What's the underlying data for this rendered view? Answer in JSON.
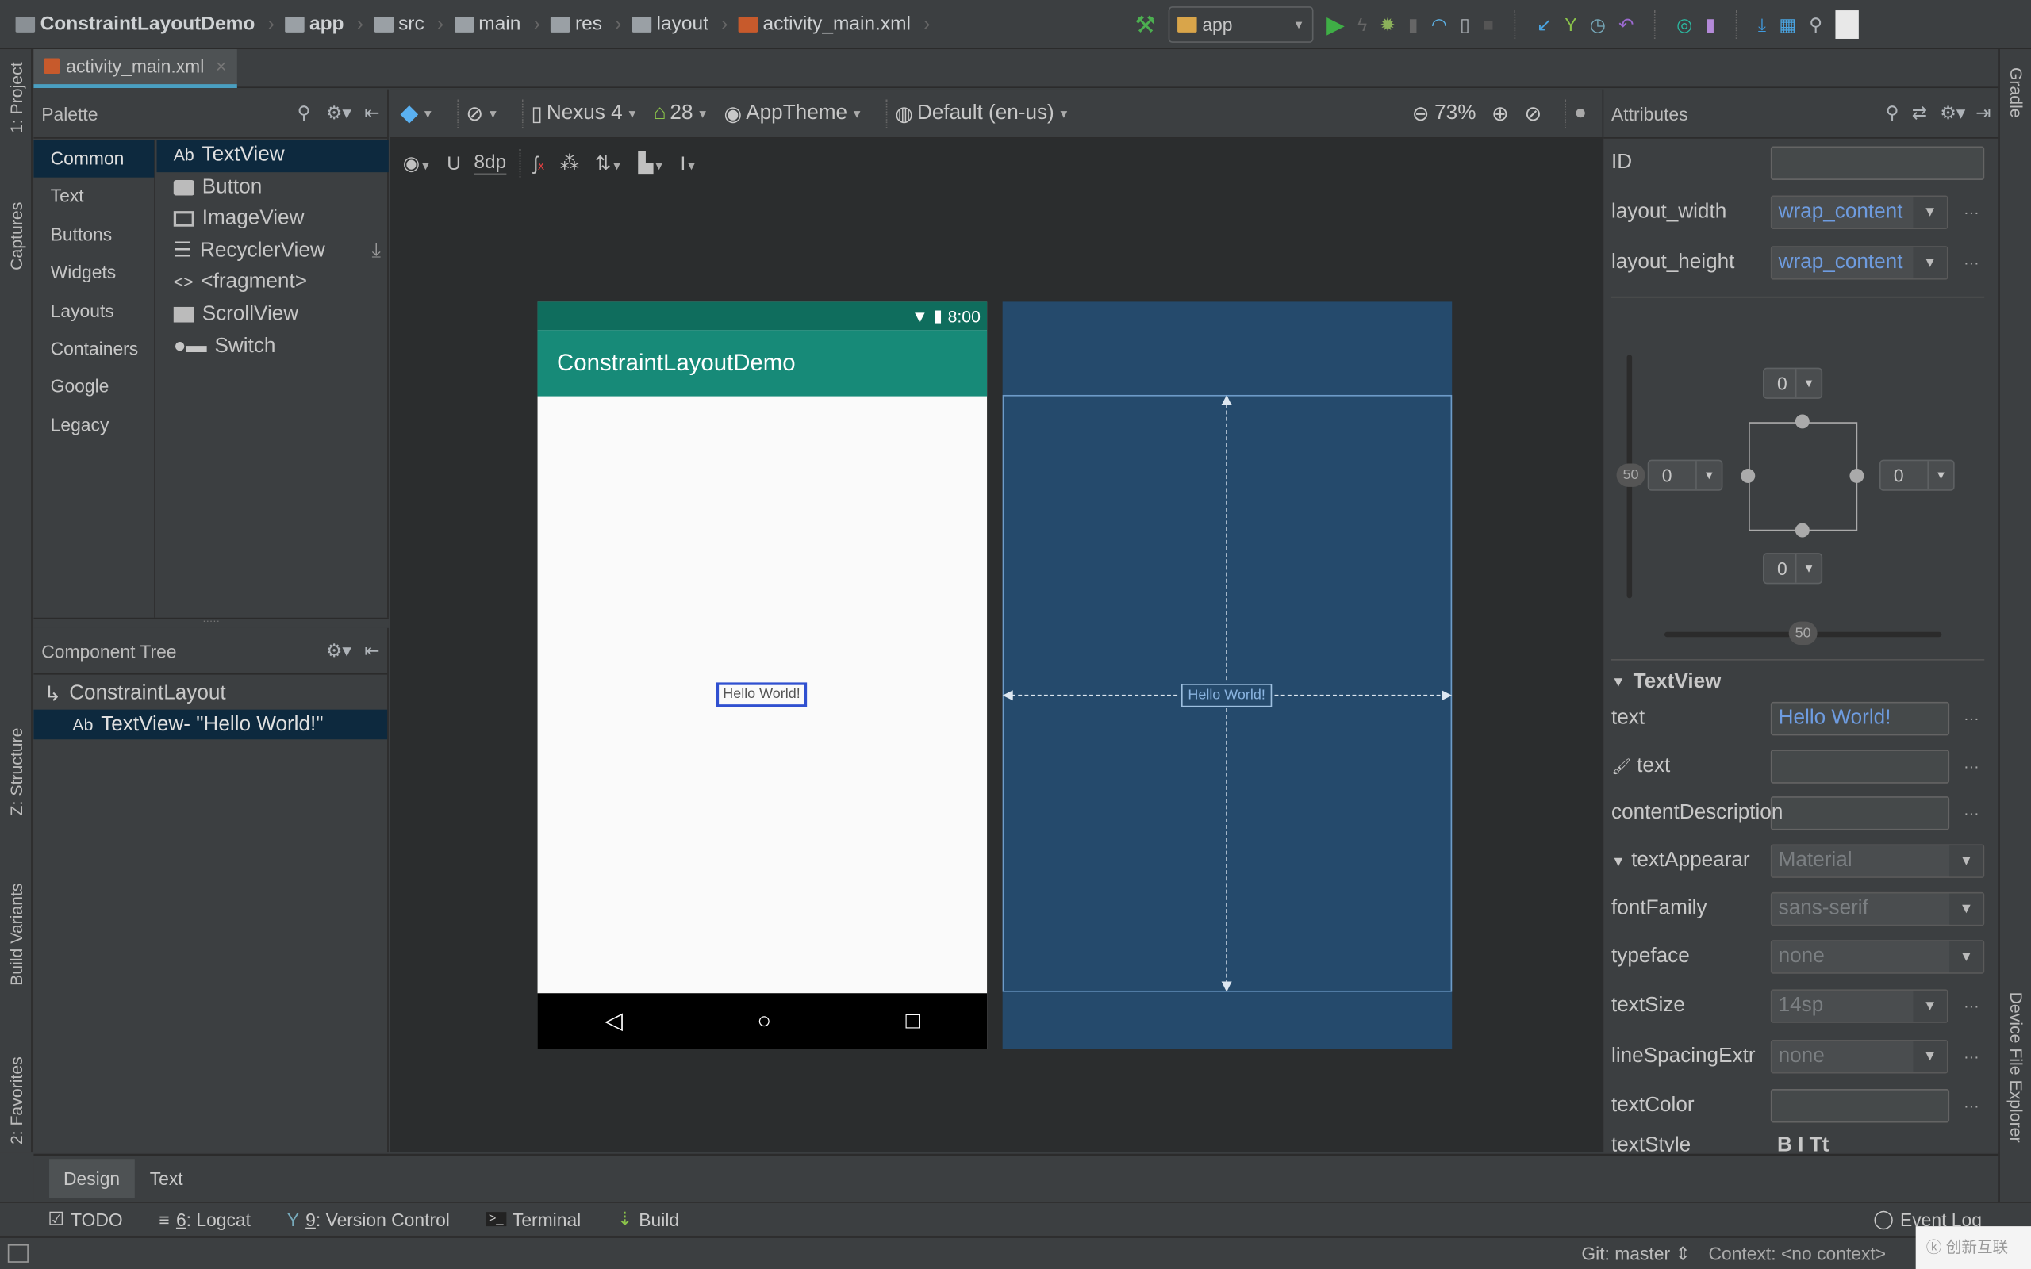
{
  "breadcrumb": [
    "ConstraintLayoutDemo",
    "app",
    "src",
    "main",
    "res",
    "layout",
    "activity_main.xml"
  ],
  "run_config": "app",
  "editor_tab": {
    "label": "activity_main.xml"
  },
  "palette": {
    "title": "Palette",
    "categories": [
      "Common",
      "Text",
      "Buttons",
      "Widgets",
      "Layouts",
      "Containers",
      "Google",
      "Legacy"
    ],
    "selected_category": "Common",
    "items": [
      {
        "icon": "Ab",
        "label": "TextView"
      },
      {
        "icon": "button-icon",
        "label": "Button"
      },
      {
        "icon": "image-icon",
        "label": "ImageView"
      },
      {
        "icon": "list-icon",
        "label": "RecyclerView"
      },
      {
        "icon": "<>",
        "label": "<fragment>"
      },
      {
        "icon": "scroll-icon",
        "label": "ScrollView"
      },
      {
        "icon": "switch-icon",
        "label": "Switch"
      }
    ]
  },
  "toolbar": {
    "device": "Nexus 4",
    "api": "28",
    "theme": "AppTheme",
    "locale": "Default (en-us)",
    "zoom": "73%",
    "margin": "8dp"
  },
  "component_tree": {
    "title": "Component Tree",
    "items": [
      {
        "label": "ConstraintLayout"
      },
      {
        "icon": "Ab",
        "label": "TextView- \"Hello World!\""
      }
    ]
  },
  "device": {
    "time": "8:00",
    "app_title": "ConstraintLayoutDemo",
    "text": "Hello World!"
  },
  "attributes": {
    "title": "Attributes",
    "id_label": "ID",
    "id_value": "",
    "layout_width_label": "layout_width",
    "layout_width": "wrap_content",
    "layout_height_label": "layout_height",
    "layout_height": "wrap_content",
    "constraints": {
      "top": "0",
      "bottom": "0",
      "left": "0",
      "right": "0",
      "vertical_bias": "50",
      "horizontal_bias": "50"
    },
    "section": "TextView",
    "rows": [
      {
        "label": "text",
        "value": "Hello World!",
        "kind": "field"
      },
      {
        "label": "text",
        "value": "",
        "kind": "field",
        "icon": "brush-icon"
      },
      {
        "label": "contentDescription",
        "value": "",
        "kind": "field"
      },
      {
        "label": "textAppearar",
        "value": "Material",
        "kind": "combo"
      },
      {
        "label": "fontFamily",
        "value": "sans-serif",
        "kind": "combo"
      },
      {
        "label": "typeface",
        "value": "none",
        "kind": "combo"
      },
      {
        "label": "textSize",
        "value": "14sp",
        "kind": "combo"
      },
      {
        "label": "lineSpacingExtr",
        "value": "none",
        "kind": "combo"
      },
      {
        "label": "textColor",
        "value": "",
        "kind": "field"
      },
      {
        "label": "textStyle",
        "value": "B  I  Tt",
        "kind": "text"
      }
    ]
  },
  "left_strip": [
    "1: Project",
    "Captures",
    "Z: Structure",
    "Build Variants",
    "2: Favorites"
  ],
  "right_strip": [
    "Gradle",
    "Device File Explorer"
  ],
  "design_tabs": [
    "Design",
    "Text"
  ],
  "bottom_tools": [
    {
      "key": "",
      "label": "TODO"
    },
    {
      "key": "6",
      "label": ": Logcat"
    },
    {
      "key": "9",
      "label": ": Version Control"
    },
    {
      "key": "",
      "label": "Terminal"
    },
    {
      "key": "",
      "label": "Build"
    }
  ],
  "event_log": "Event Log",
  "status": {
    "git": "Git: master",
    "context": "Context: <no context>"
  },
  "colors": {
    "accent": "#4a9fc1",
    "blueprint": "#254a6c",
    "appbar": "#178a78",
    "statusbar": "#0f6d5d",
    "selection": "#0d293e"
  }
}
